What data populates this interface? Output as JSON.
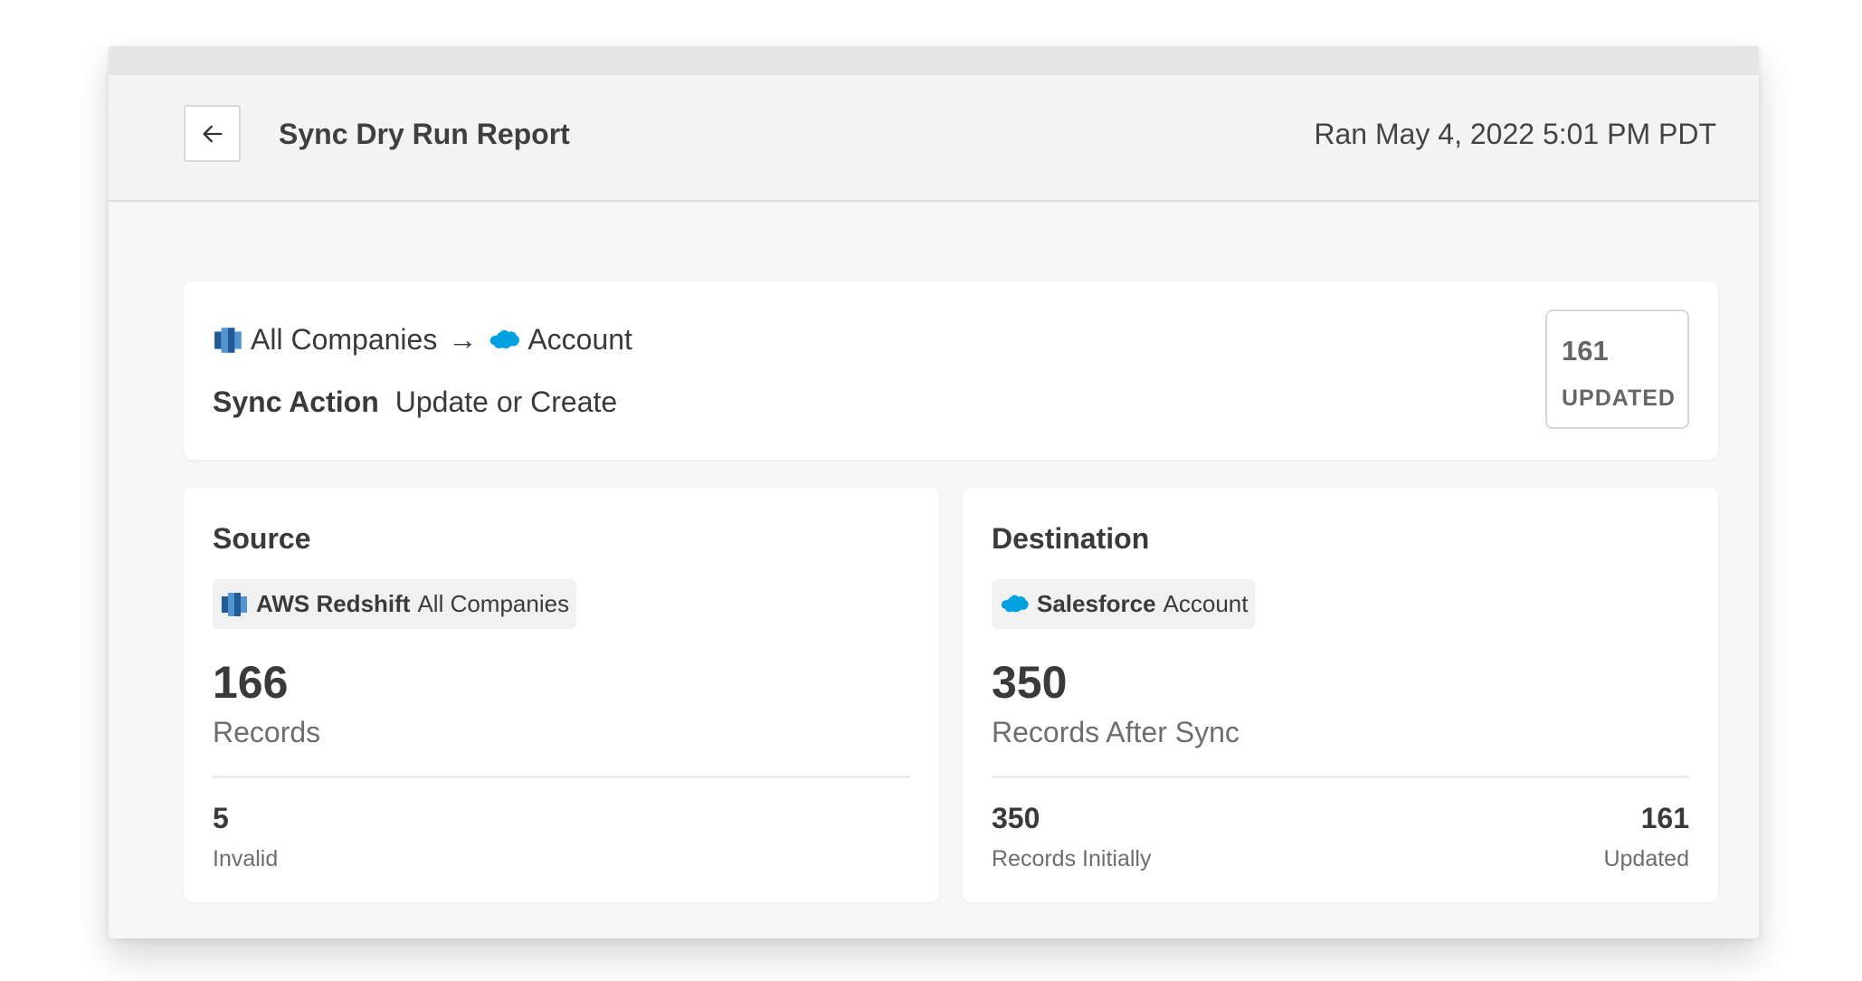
{
  "header": {
    "title": "Sync Dry Run Report",
    "ran_time": "Ran May 4, 2022 5:01 PM PDT",
    "back_icon": "arrow-left-icon"
  },
  "summary": {
    "source_model": "All Companies",
    "arrow": "→",
    "destination_object": "Account",
    "sync_action_label": "Sync Action",
    "sync_action_value": "Update or Create",
    "badge_count": "161",
    "badge_label": "UPDATED"
  },
  "source": {
    "title": "Source",
    "connector": "AWS Redshift",
    "model": "All Companies",
    "records_count": "166",
    "records_label": "Records",
    "invalid_count": "5",
    "invalid_label": "Invalid"
  },
  "destination": {
    "title": "Destination",
    "connector": "Salesforce",
    "object": "Account",
    "records_count": "350",
    "records_label": "Records After Sync",
    "initial_count": "350",
    "initial_label": "Records Initially",
    "updated_count": "161",
    "updated_label": "Updated"
  },
  "colors": {
    "redshift_blue": "#205b97",
    "redshift_light": "#5294cf",
    "salesforce_blue": "#00a1e0"
  }
}
